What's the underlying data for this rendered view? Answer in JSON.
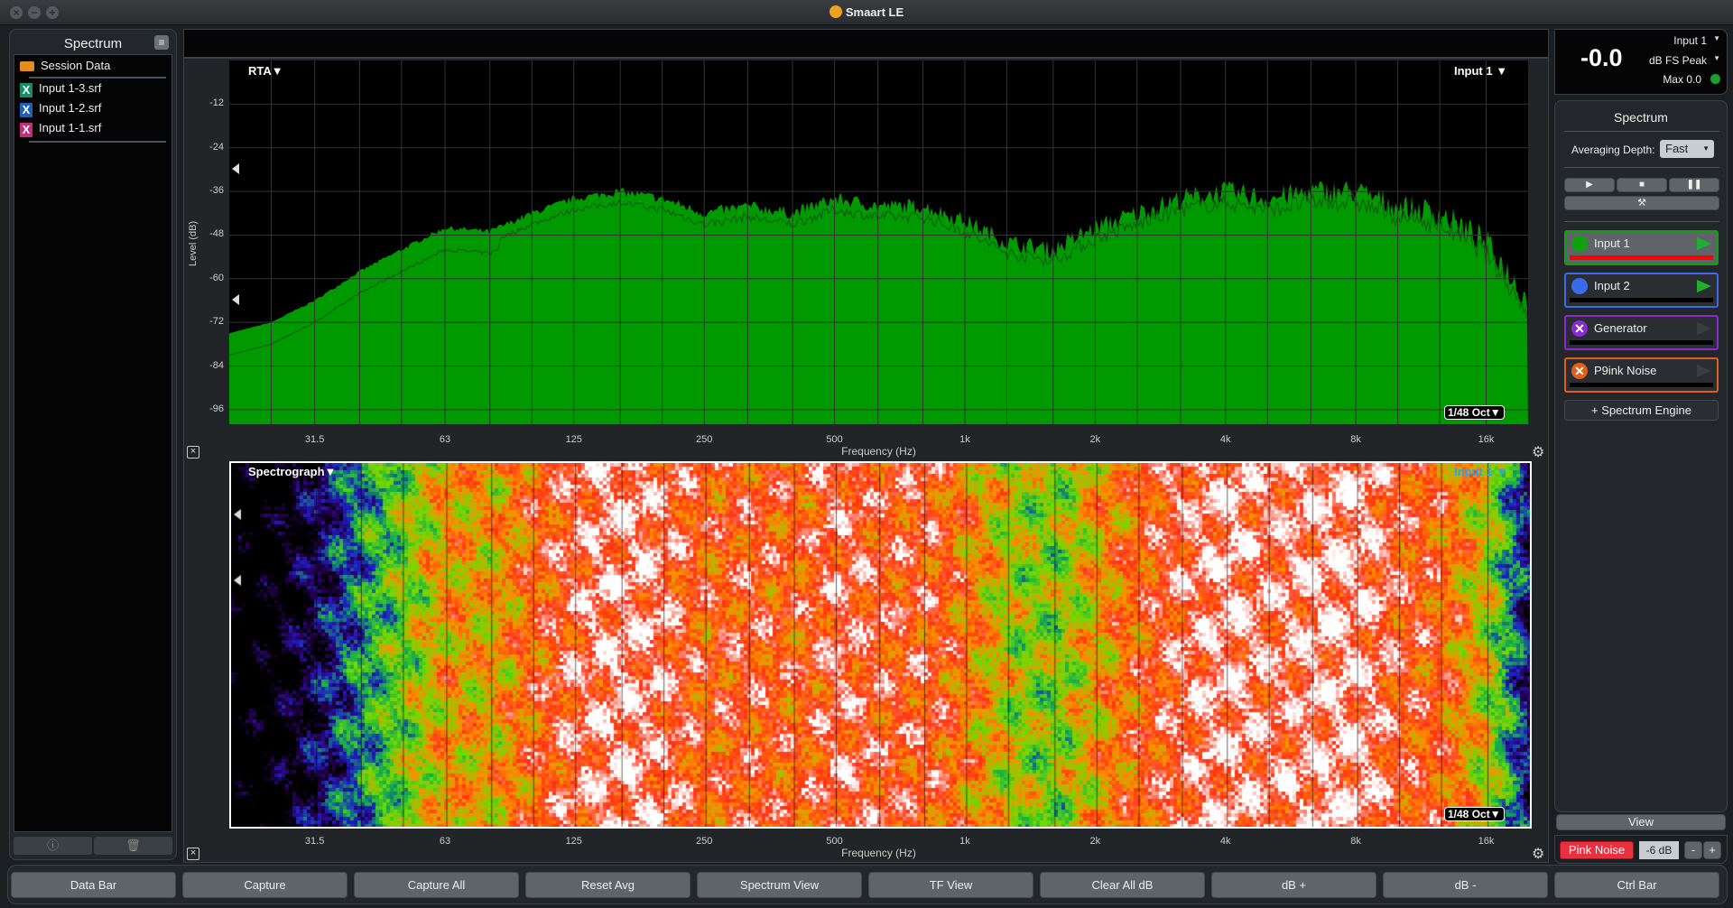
{
  "window": {
    "title": "Smaart LE",
    "controls": [
      "close",
      "minimize",
      "maximize"
    ]
  },
  "left_panel": {
    "title": "Spectrum",
    "folder": "Session Data",
    "files": [
      {
        "name": "Input 1-3.srf",
        "color": "#1a8a6a"
      },
      {
        "name": "Input 1-2.srf",
        "color": "#1f5fb8"
      },
      {
        "name": "Input 1-1.srf",
        "color": "#c0307a"
      }
    ],
    "icons": [
      "info-icon",
      "trash-icon"
    ]
  },
  "rta": {
    "mode_label": "RTA▼",
    "input_label": "Input 1 ▼",
    "resolution_label": "1/48 Oct▼",
    "ylabel": "Level (dB)",
    "xlabel": "Frequency (Hz)",
    "yticks": [
      "-12",
      "-24",
      "-36",
      "-48",
      "-60",
      "-72",
      "-84",
      "-96"
    ],
    "xticks": [
      "31.5",
      "63",
      "125",
      "250",
      "500",
      "1k",
      "2k",
      "4k",
      "8k",
      "16k"
    ],
    "fill_color": "#009a00"
  },
  "spectrograph": {
    "mode_label": "Spectrograph▼",
    "input_label": "Input 1 ▼",
    "resolution_label": "1/48 Oct▼",
    "xlabel": "Frequency (Hz)",
    "xticks": [
      "31.5",
      "63",
      "125",
      "250",
      "500",
      "1k",
      "2k",
      "4k",
      "8k",
      "16k"
    ]
  },
  "chart_data": {
    "type": "area",
    "series": [
      {
        "name": "Input 1",
        "x": [
          20,
          25,
          31.5,
          40,
          50,
          63,
          80,
          100,
          125,
          160,
          200,
          250,
          315,
          400,
          500,
          630,
          800,
          1000,
          1250,
          1600,
          2000,
          2500,
          3150,
          4000,
          5000,
          6300,
          8000,
          10000,
          12500,
          16000,
          20000
        ],
        "values": [
          -75,
          -72,
          -66,
          -58,
          -52,
          -46,
          -47,
          -42,
          -38,
          -36,
          -38,
          -42,
          -40,
          -42,
          -38,
          -40,
          -40,
          -44,
          -50,
          -52,
          -46,
          -42,
          -38,
          -36,
          -38,
          -36,
          -36,
          -40,
          -42,
          -50,
          -66
        ]
      }
    ],
    "xlabel": "Frequency (Hz)",
    "ylabel": "Level (dB)",
    "xscale": "log",
    "xlim": [
      20,
      20000
    ],
    "ylim": [
      -100,
      0
    ],
    "grid": true
  },
  "meter": {
    "value": "-0.0",
    "input": "Input 1",
    "units": "dB FS Peak",
    "max": "Max 0.0",
    "status_color": "#1aa030"
  },
  "spectrum_panel": {
    "title": "Spectrum",
    "averaging_label": "Averaging Depth:",
    "averaging_value": "Fast",
    "engines": [
      {
        "name": "Input 1",
        "color": "#10a010",
        "active": true
      },
      {
        "name": "Input 2",
        "color": "#3a6ae8",
        "active": true
      },
      {
        "name": "Generator",
        "color": "#8a2ad0",
        "active": false
      },
      {
        "name": "P9ink Noise",
        "color": "#e0601a",
        "active": false
      }
    ],
    "add_engine": "+ Spectrum Engine",
    "view": "View",
    "generator_button": "Pink Noise",
    "generator_level": "-6 dB",
    "minus": "-",
    "plus": "+"
  },
  "bottom_bar": [
    "Data Bar",
    "Capture",
    "Capture All",
    "Reset Avg",
    "Spectrum View",
    "TF View",
    "Clear All dB",
    "dB +",
    "dB -",
    "Ctrl Bar"
  ]
}
